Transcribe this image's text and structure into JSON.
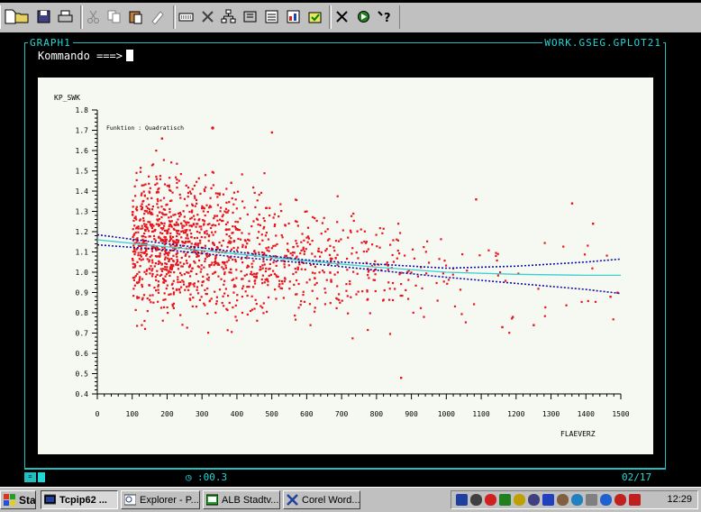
{
  "toolbar": {
    "buttons": [
      {
        "name": "new-file-icon"
      },
      {
        "name": "open-folder-icon"
      },
      {
        "name": "save-icon"
      },
      {
        "name": "print-icon"
      },
      {
        "name": "cut-icon"
      },
      {
        "name": "copy-icon"
      },
      {
        "name": "paste-icon"
      },
      {
        "name": "clear-icon"
      },
      {
        "name": "keys-icon"
      },
      {
        "name": "options-icon"
      },
      {
        "name": "explorer-icon"
      },
      {
        "name": "libraries-icon"
      },
      {
        "name": "output-icon"
      },
      {
        "name": "results-icon"
      },
      {
        "name": "log-icon"
      },
      {
        "name": "tools-icon"
      },
      {
        "name": "run-icon"
      },
      {
        "name": "help-icon"
      }
    ]
  },
  "window": {
    "left_title": "GRAPH1",
    "right_title": "WORK.GSEG.GPLOT21",
    "command_label": "Kommando ===>",
    "command_value": ""
  },
  "status": {
    "timer": ":00.3",
    "page": "02/17"
  },
  "chart_data": {
    "type": "scatter",
    "ylabel": "KP_SWK",
    "xlabel": "FLAEVERZ",
    "legend": "Funktion : Quadratisch",
    "legend_position": "top-left",
    "xlim": [
      0,
      1500
    ],
    "ylim": [
      0.4,
      1.8
    ],
    "x_ticks": [
      "0",
      "100",
      "200",
      "300",
      "400",
      "500",
      "600",
      "700",
      "800",
      "900",
      "1000",
      "1100",
      "1200",
      "1300",
      "1400",
      "1500"
    ],
    "y_ticks": [
      "0.4",
      "0.5",
      "0.6",
      "0.7",
      "0.8",
      "0.9",
      "1.0",
      "1.1",
      "1.2",
      "1.3",
      "1.4",
      "1.5",
      "1.6",
      "1.7",
      "1.8"
    ],
    "colors": {
      "points": "#e8141e",
      "fit": "#38d0d0",
      "band": "#1010a0"
    },
    "point_density": [
      {
        "x_from": 100,
        "x_to": 200,
        "count": 380
      },
      {
        "x_from": 200,
        "x_to": 300,
        "count": 330
      },
      {
        "x_from": 300,
        "x_to": 400,
        "count": 230
      },
      {
        "x_from": 400,
        "x_to": 500,
        "count": 150
      },
      {
        "x_from": 500,
        "x_to": 600,
        "count": 110
      },
      {
        "x_from": 600,
        "x_to": 700,
        "count": 85
      },
      {
        "x_from": 700,
        "x_to": 800,
        "count": 60
      },
      {
        "x_from": 800,
        "x_to": 900,
        "count": 45
      },
      {
        "x_from": 900,
        "x_to": 1000,
        "count": 22
      },
      {
        "x_from": 1000,
        "x_to": 1100,
        "count": 12
      },
      {
        "x_from": 1100,
        "x_to": 1200,
        "count": 10
      },
      {
        "x_from": 1200,
        "x_to": 1300,
        "count": 5
      },
      {
        "x_from": 1300,
        "x_to": 1400,
        "count": 4
      },
      {
        "x_from": 1400,
        "x_to": 1500,
        "count": 6
      }
    ],
    "outliers": [
      {
        "x": 185,
        "y": 1.66
      },
      {
        "x": 500,
        "y": 1.69
      },
      {
        "x": 870,
        "y": 0.48
      },
      {
        "x": 1360,
        "y": 1.34
      },
      {
        "x": 1420,
        "y": 1.24
      },
      {
        "x": 1085,
        "y": 1.36
      },
      {
        "x": 1160,
        "y": 0.73
      },
      {
        "x": 1190,
        "y": 0.78
      },
      {
        "x": 1250,
        "y": 0.74
      },
      {
        "x": 1490,
        "y": 0.9
      },
      {
        "x": 1470,
        "y": 0.88
      }
    ],
    "fit": {
      "x": [
        0,
        200,
        400,
        600,
        800,
        1000,
        1200,
        1400,
        1500
      ],
      "y": [
        1.16,
        1.125,
        1.09,
        1.055,
        1.025,
        1.0,
        0.99,
        0.985,
        0.985
      ]
    },
    "band_upper": {
      "x": [
        0,
        200,
        400,
        600,
        800,
        1000,
        1200,
        1400,
        1500
      ],
      "y": [
        1.185,
        1.14,
        1.1,
        1.06,
        1.04,
        1.02,
        1.03,
        1.05,
        1.065
      ]
    },
    "band_lower": {
      "x": [
        0,
        200,
        400,
        600,
        800,
        1000,
        1200,
        1400,
        1500
      ],
      "y": [
        1.135,
        1.11,
        1.075,
        1.045,
        1.01,
        0.975,
        0.945,
        0.915,
        0.895
      ]
    }
  },
  "taskbar": {
    "start": "Start",
    "tasks": [
      {
        "label": "Tcpip62 ..."
      },
      {
        "label": "Explorer - P..."
      },
      {
        "label": "ALB Stadtv..."
      },
      {
        "label": "Corel Word..."
      }
    ],
    "tray_icons": [
      "monitor-icon",
      "network-icon",
      "antivirus-icon",
      "tools-icon",
      "pen-icon",
      "keyboard-icon",
      "bar-icon",
      "hand-icon",
      "chart-icon",
      "clipboard-icon",
      "globe-icon",
      "plug-icon",
      "question-icon"
    ],
    "clock": "12:29"
  }
}
